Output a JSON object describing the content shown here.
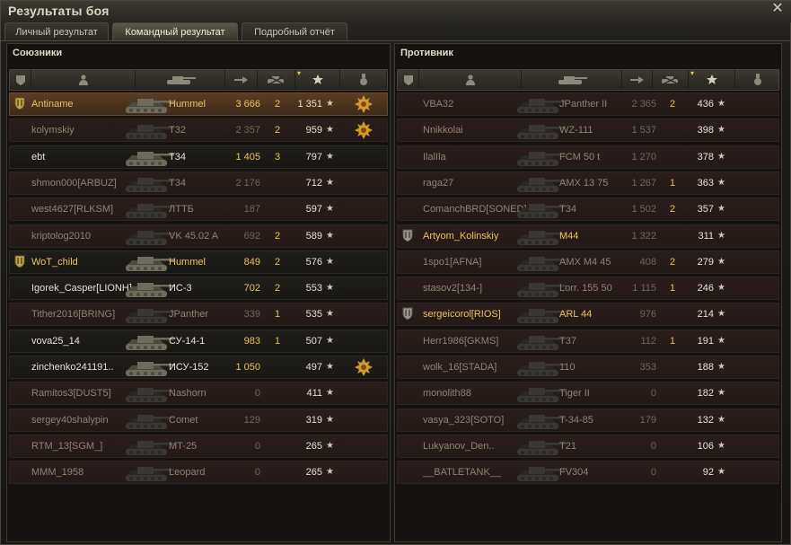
{
  "window": {
    "title": "Результаты боя",
    "close_icon": "close-icon"
  },
  "tabs": [
    {
      "label": "Личный результат",
      "active": false
    },
    {
      "label": "Командный результат",
      "active": true
    },
    {
      "label": "Подробный отчёт",
      "active": false
    }
  ],
  "allies": {
    "title": "Союзники",
    "columns": [
      "platoon-icon",
      "player-icon",
      "tank-icon",
      "damage-icon",
      "kills-icon",
      "xp-star-icon",
      "medal-icon"
    ],
    "rows": [
      {
        "name": "Antiname",
        "vehicle": "Hummel",
        "damage": "3 666",
        "kills": "2",
        "xp": "1 351",
        "platoon": true,
        "alive": true,
        "player": true,
        "medal": true
      },
      {
        "name": "kolymskiy",
        "vehicle": "T32",
        "damage": "2 357",
        "kills": "2",
        "xp": "959",
        "platoon": false,
        "alive": false,
        "player": false,
        "medal": true
      },
      {
        "name": "ebt",
        "vehicle": "T34",
        "damage": "1 405",
        "kills": "3",
        "xp": "797",
        "platoon": false,
        "alive": true,
        "player": false,
        "medal": false
      },
      {
        "name": "shmon000[ARBUZ]",
        "vehicle": "T34",
        "damage": "2 176",
        "kills": "",
        "xp": "712",
        "platoon": false,
        "alive": false,
        "player": false,
        "medal": false
      },
      {
        "name": "west4627[RLKSM]",
        "vehicle": "ЛТТБ",
        "damage": "187",
        "kills": "",
        "xp": "597",
        "platoon": false,
        "alive": false,
        "player": false,
        "medal": false
      },
      {
        "name": "kriptolog2010",
        "vehicle": "VK 45.02 A",
        "damage": "692",
        "kills": "2",
        "xp": "589",
        "platoon": false,
        "alive": false,
        "player": false,
        "medal": false
      },
      {
        "name": "WoT_child",
        "vehicle": "Hummel",
        "damage": "849",
        "kills": "2",
        "xp": "576",
        "platoon": true,
        "alive": true,
        "player": false,
        "medal": false
      },
      {
        "name": "Igorek_Casper[LIONH]",
        "vehicle": "ИС-3",
        "damage": "702",
        "kills": "2",
        "xp": "553",
        "platoon": false,
        "alive": true,
        "player": false,
        "medal": false
      },
      {
        "name": "Tither2016[BRING]",
        "vehicle": "JPanther",
        "damage": "339",
        "kills": "1",
        "xp": "535",
        "platoon": false,
        "alive": false,
        "player": false,
        "medal": false
      },
      {
        "name": "vova25_14",
        "vehicle": "СУ-14-1",
        "damage": "983",
        "kills": "1",
        "xp": "507",
        "platoon": false,
        "alive": true,
        "player": false,
        "medal": false
      },
      {
        "name": "zinchenko241191..",
        "vehicle": "ИСУ-152",
        "damage": "1 050",
        "kills": "",
        "xp": "497",
        "platoon": false,
        "alive": true,
        "player": false,
        "medal": true
      },
      {
        "name": "Ramitos3[DUST5]",
        "vehicle": "Nashorn",
        "damage": "0",
        "kills": "",
        "xp": "411",
        "platoon": false,
        "alive": false,
        "player": false,
        "medal": false
      },
      {
        "name": "sergey40shalypin",
        "vehicle": "Comet",
        "damage": "129",
        "kills": "",
        "xp": "319",
        "platoon": false,
        "alive": false,
        "player": false,
        "medal": false
      },
      {
        "name": "RTM_13[SGM_]",
        "vehicle": "MT-25",
        "damage": "0",
        "kills": "",
        "xp": "265",
        "platoon": false,
        "alive": false,
        "player": false,
        "medal": false
      },
      {
        "name": "MMM_1958",
        "vehicle": "Leopard",
        "damage": "0",
        "kills": "",
        "xp": "265",
        "platoon": false,
        "alive": false,
        "player": false,
        "medal": false
      }
    ]
  },
  "enemies": {
    "title": "Противник",
    "rows": [
      {
        "name": "VBA32",
        "vehicle": "JPanther II",
        "damage": "2 365",
        "kills": "2",
        "xp": "436",
        "platoon": false,
        "alive": false
      },
      {
        "name": "Nnikkolai",
        "vehicle": "WZ-111",
        "damage": "1 537",
        "kills": "",
        "xp": "398",
        "platoon": false,
        "alive": false
      },
      {
        "name": "IlalIla",
        "vehicle": "FCM 50 t",
        "damage": "1 270",
        "kills": "",
        "xp": "378",
        "platoon": false,
        "alive": false
      },
      {
        "name": "raga27",
        "vehicle": "AMX 13 75",
        "damage": "1 267",
        "kills": "1",
        "xp": "363",
        "platoon": false,
        "alive": false
      },
      {
        "name": "ComanchBRD[SONED]",
        "vehicle": "T34",
        "damage": "1 502",
        "kills": "2",
        "xp": "357",
        "platoon": false,
        "alive": false
      },
      {
        "name": "Artyom_Kolinskiy",
        "vehicle": "M44",
        "damage": "1 322",
        "kills": "",
        "xp": "311",
        "platoon": true,
        "alive": false
      },
      {
        "name": "1spo1[AFNA]",
        "vehicle": "AMX M4 45",
        "damage": "408",
        "kills": "2",
        "xp": "279",
        "platoon": false,
        "alive": false
      },
      {
        "name": "stasov2[134-]",
        "vehicle": "Lorr. 155 50",
        "damage": "1 115",
        "kills": "1",
        "xp": "246",
        "platoon": false,
        "alive": false
      },
      {
        "name": "sergeicorol[RIOS]",
        "vehicle": "ARL 44",
        "damage": "976",
        "kills": "",
        "xp": "214",
        "platoon": true,
        "alive": false
      },
      {
        "name": "Herr1986[GKMS]",
        "vehicle": "T37",
        "damage": "112",
        "kills": "1",
        "xp": "191",
        "platoon": false,
        "alive": false
      },
      {
        "name": "wolk_16[STADA]",
        "vehicle": "110",
        "damage": "353",
        "kills": "",
        "xp": "188",
        "platoon": false,
        "alive": false
      },
      {
        "name": "monolith88",
        "vehicle": "Tiger II",
        "damage": "0",
        "kills": "",
        "xp": "182",
        "platoon": false,
        "alive": false
      },
      {
        "name": "vasya_323[SOTO]",
        "vehicle": "T-34-85",
        "damage": "179",
        "kills": "",
        "xp": "132",
        "platoon": false,
        "alive": false
      },
      {
        "name": "Lukyanov_Den..",
        "vehicle": "T21",
        "damage": "0",
        "kills": "",
        "xp": "106",
        "platoon": false,
        "alive": false
      },
      {
        "name": "__BATLETANK__",
        "vehicle": "FV304",
        "damage": "0",
        "kills": "",
        "xp": "92",
        "platoon": false,
        "alive": false
      }
    ]
  },
  "colors": {
    "accent_gold": "#e9c35a",
    "dead_row": "#2a1e1c",
    "player_row": "#5a3d22"
  }
}
